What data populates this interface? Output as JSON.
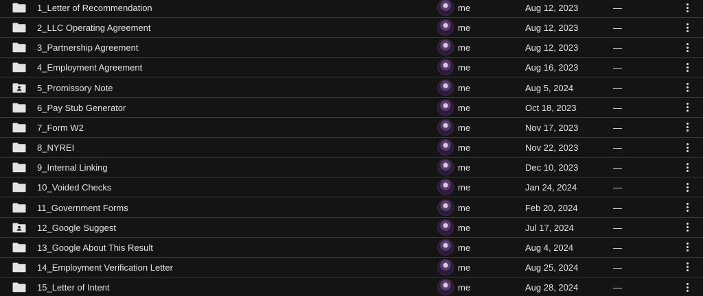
{
  "rows": [
    {
      "name": "1_Letter of Recommendation",
      "icon": "folder-icon",
      "owner": "me",
      "modified": "Aug 12, 2023",
      "size": "—"
    },
    {
      "name": "2_LLC Operating Agreement",
      "icon": "folder-icon",
      "owner": "me",
      "modified": "Aug 12, 2023",
      "size": "—"
    },
    {
      "name": "3_Partnership Agreement",
      "icon": "folder-icon",
      "owner": "me",
      "modified": "Aug 12, 2023",
      "size": "—"
    },
    {
      "name": "4_Employment Agreement",
      "icon": "folder-icon",
      "owner": "me",
      "modified": "Aug 16, 2023",
      "size": "—"
    },
    {
      "name": "5_Promissory Note",
      "icon": "shared-folder-icon",
      "owner": "me",
      "modified": "Aug 5, 2024",
      "size": "—"
    },
    {
      "name": "6_Pay Stub Generator",
      "icon": "folder-icon",
      "owner": "me",
      "modified": "Oct 18, 2023",
      "size": "—"
    },
    {
      "name": "7_Form W2",
      "icon": "folder-icon",
      "owner": "me",
      "modified": "Nov 17, 2023",
      "size": "—"
    },
    {
      "name": "8_NYREI",
      "icon": "folder-icon",
      "owner": "me",
      "modified": "Nov 22, 2023",
      "size": "—"
    },
    {
      "name": "9_Internal Linking",
      "icon": "folder-icon",
      "owner": "me",
      "modified": "Dec 10, 2023",
      "size": "—"
    },
    {
      "name": "10_Voided Checks",
      "icon": "folder-icon",
      "owner": "me",
      "modified": "Jan 24, 2024",
      "size": "—"
    },
    {
      "name": "11_Government Forms",
      "icon": "folder-icon",
      "owner": "me",
      "modified": "Feb 20, 2024",
      "size": "—"
    },
    {
      "name": "12_Google Suggest",
      "icon": "shared-folder-icon",
      "owner": "me",
      "modified": "Jul 17, 2024",
      "size": "—"
    },
    {
      "name": "13_Google About This Result",
      "icon": "folder-icon",
      "owner": "me",
      "modified": "Aug 4, 2024",
      "size": "—"
    },
    {
      "name": "14_Employment Verification Letter",
      "icon": "folder-icon",
      "owner": "me",
      "modified": "Aug 25, 2024",
      "size": "—"
    },
    {
      "name": "15_Letter of Intent",
      "icon": "folder-icon",
      "owner": "me",
      "modified": "Aug 28, 2024",
      "size": "—"
    }
  ],
  "colors": {
    "background": "#141414",
    "text": "#e3e3e3",
    "divider": "#3c3c3c",
    "icon": "#e3e3e3"
  }
}
